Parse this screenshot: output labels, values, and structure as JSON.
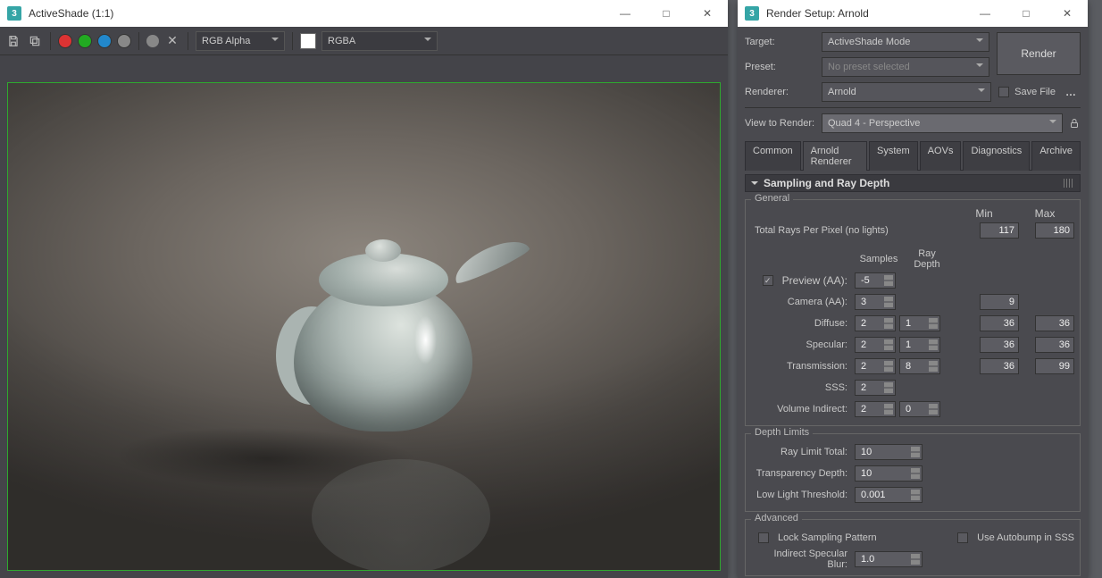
{
  "activeshade": {
    "title": "ActiveShade (1:1)",
    "channel": "RGB Alpha",
    "format": "RGBA"
  },
  "rendersetup": {
    "title": "Render Setup: Arnold",
    "target_label": "Target:",
    "target": "ActiveShade Mode",
    "preset_label": "Preset:",
    "preset": "No preset selected",
    "renderer_label": "Renderer:",
    "renderer": "Arnold",
    "save_file_label": "Save File",
    "render_btn": "Render",
    "view_label": "View to Render:",
    "view": "Quad 4 - Perspective",
    "tabs": [
      "Common",
      "Arnold Renderer",
      "System",
      "AOVs",
      "Diagnostics",
      "Archive"
    ],
    "rollup": "Sampling and Ray Depth",
    "general": {
      "label": "General",
      "min_label": "Min",
      "max_label": "Max",
      "total_label": "Total Rays Per Pixel (no lights)",
      "total_min": "117",
      "total_max": "180",
      "samples_label": "Samples",
      "raydepth_label": "Ray Depth",
      "preview_label": "Preview (AA):",
      "preview_val": "-5",
      "camera_label": "Camera (AA):",
      "camera_samples": "3",
      "camera_max": "9",
      "diffuse_label": "Diffuse:",
      "diffuse_samples": "2",
      "diffuse_depth": "1",
      "diffuse_min": "36",
      "diffuse_max": "36",
      "specular_label": "Specular:",
      "specular_samples": "2",
      "specular_depth": "1",
      "specular_min": "36",
      "specular_max": "36",
      "trans_label": "Transmission:",
      "trans_samples": "2",
      "trans_depth": "8",
      "trans_min": "36",
      "trans_max": "99",
      "sss_label": "SSS:",
      "sss_samples": "2",
      "vind_label": "Volume Indirect:",
      "vind_samples": "2",
      "vind_depth": "0"
    },
    "depth": {
      "label": "Depth Limits",
      "ray_total_label": "Ray Limit Total:",
      "ray_total": "10",
      "transp_label": "Transparency Depth:",
      "transp": "10",
      "lowlight_label": "Low Light Threshold:",
      "lowlight": "0.001"
    },
    "advanced": {
      "label": "Advanced",
      "lock_label": "Lock Sampling Pattern",
      "autobump_label": "Use Autobump in SSS",
      "ind_spec_label": "Indirect Specular Blur:",
      "ind_spec": "1.0"
    }
  }
}
